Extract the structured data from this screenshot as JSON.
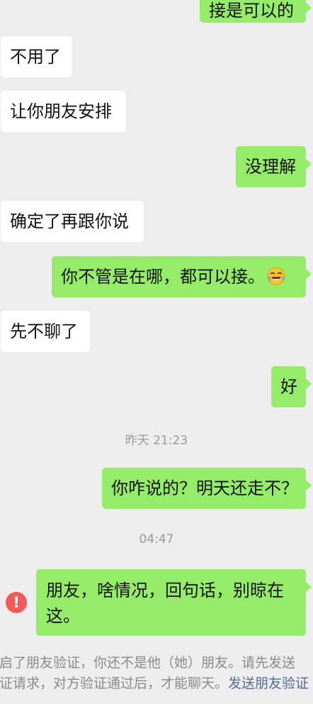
{
  "messages": {
    "m1": "接是可以的",
    "m2": "不用了",
    "m3": "让你朋友安排",
    "m4": "没理解",
    "m5": "确定了再跟你说",
    "m6": "你不管是在哪，都可以接。",
    "m7": "先不聊了",
    "m8": "好",
    "m9": "你咋说的？明天还走不？",
    "m10": "朋友，啥情况，回句话，别晾在这。"
  },
  "timestamps": {
    "t1": "昨天 21:23",
    "t2": "04:47"
  },
  "status": {
    "send_failed_icon": "!"
  },
  "notice": {
    "line1": "启了朋友验证，你还不是他（她）朋友。请先发送",
    "line2_prefix": "证请求，对方验证通过后，才能聊天。",
    "link": "发送朋友验证"
  },
  "colors": {
    "background": "#ededed",
    "incoming_bubble": "#ffffff",
    "outgoing_bubble": "#95ec69",
    "timestamp_text": "#9a9a9a",
    "link": "#576b95",
    "error": "#f25a5a"
  },
  "icons": {
    "emoji": "laughing-crying-face",
    "error": "exclamation-circle"
  }
}
